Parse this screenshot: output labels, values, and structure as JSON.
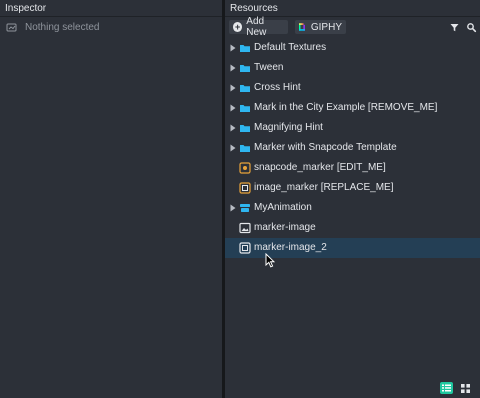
{
  "inspector": {
    "title": "Inspector",
    "empty_label": "Nothing selected"
  },
  "resources": {
    "title": "Resources",
    "add_new_label": "Add New",
    "giphy_label": "GIPHY",
    "items": [
      {
        "label": "Default Textures",
        "icon": "folder-icon",
        "expandable": true
      },
      {
        "label": "Tween",
        "icon": "folder-icon",
        "expandable": true
      },
      {
        "label": "Cross Hint",
        "icon": "folder-icon",
        "expandable": true
      },
      {
        "label": "Mark in the City Example [REMOVE_ME]",
        "icon": "folder-icon",
        "expandable": true
      },
      {
        "label": "Magnifying Hint",
        "icon": "folder-icon",
        "expandable": true
      },
      {
        "label": "Marker with Snapcode Template",
        "icon": "folder-icon",
        "expandable": true
      },
      {
        "label": "snapcode_marker [EDIT_ME]",
        "icon": "marker-icon",
        "expandable": false
      },
      {
        "label": "image_marker [REPLACE_ME]",
        "icon": "marker-icon",
        "expandable": false
      },
      {
        "label": "MyAnimation",
        "icon": "animation-icon",
        "expandable": true
      },
      {
        "label": "marker-image",
        "icon": "image-icon",
        "expandable": false
      },
      {
        "label": "marker-image_2",
        "icon": "marker-image-icon",
        "expandable": false,
        "selected": true
      }
    ]
  },
  "colors": {
    "panel_bg": "#2c3038",
    "selected_row": "#243f55",
    "folder_blue": "#2fb6f0",
    "marker_orange": "#e8a33a",
    "accent_teal": "#1fc79f"
  }
}
